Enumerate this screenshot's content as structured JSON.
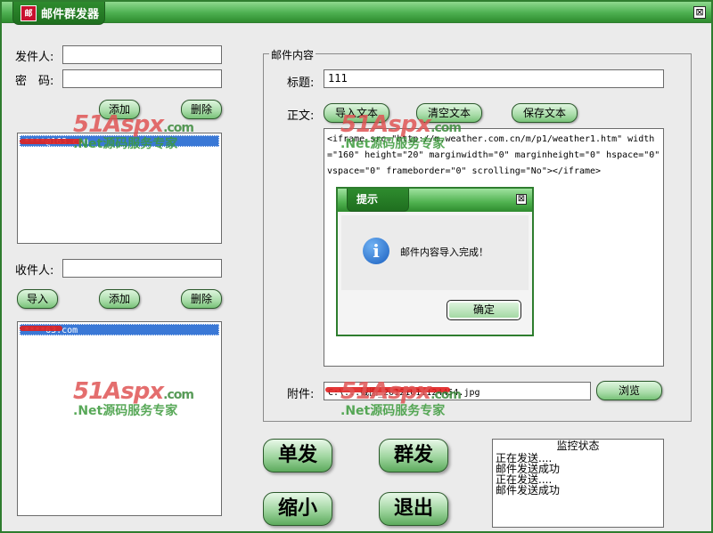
{
  "window": {
    "title": "邮件群发器",
    "icon_text": "邮"
  },
  "sender": {
    "from_label": "发件人:",
    "from_value": "",
    "password_label": "密　码:",
    "password_value": "",
    "add_label": "添加",
    "delete_label": "删除",
    "list": [
      "****@163.com"
    ]
  },
  "recipient": {
    "label": "收件人:",
    "value": "",
    "import_label": "导入",
    "add_label": "添加",
    "delete_label": "删除",
    "list": [
      "****63.com"
    ]
  },
  "mail": {
    "group_title": "邮件内容",
    "subject_label": "标题:",
    "subject_value": "111",
    "body_label": "正文:",
    "import_text_label": "导入文本",
    "clear_text_label": "清空文本",
    "save_text_label": "保存文本",
    "body_value": "<iframe src=\"http://m.weather.com.cn/m/p1/weather1.htm\" width=\"160\" height=\"20\" marginwidth=\"0\" marginheight=\"0\" hspace=\"0\" vspace=\"0\" frameborder=\"0\" scrolling=\"No\"></iframe>",
    "attachment_label": "附件:",
    "attachment_value": "C:\\...截图_20121011124454.jpg",
    "browse_label": "浏览"
  },
  "actions": {
    "single_send": "单发",
    "group_send": "群发",
    "minimize": "缩小",
    "exit": "退出"
  },
  "monitor": {
    "title": "监控状态",
    "lines": [
      "正在发送....",
      "邮件发送成功",
      "正在发送....",
      "邮件发送成功"
    ]
  },
  "dialog": {
    "title": "提示",
    "message": "邮件内容导入完成！",
    "ok_label": "确定",
    "close_glyph": "⊠"
  },
  "watermark": {
    "brand": "51Aspx",
    "domain": ".com",
    "subtitle": ".Net源码服务专家"
  },
  "colors": {
    "title_green": "#4caf50",
    "selection_blue": "#3a78d6",
    "button_green": "#a9dca9"
  }
}
